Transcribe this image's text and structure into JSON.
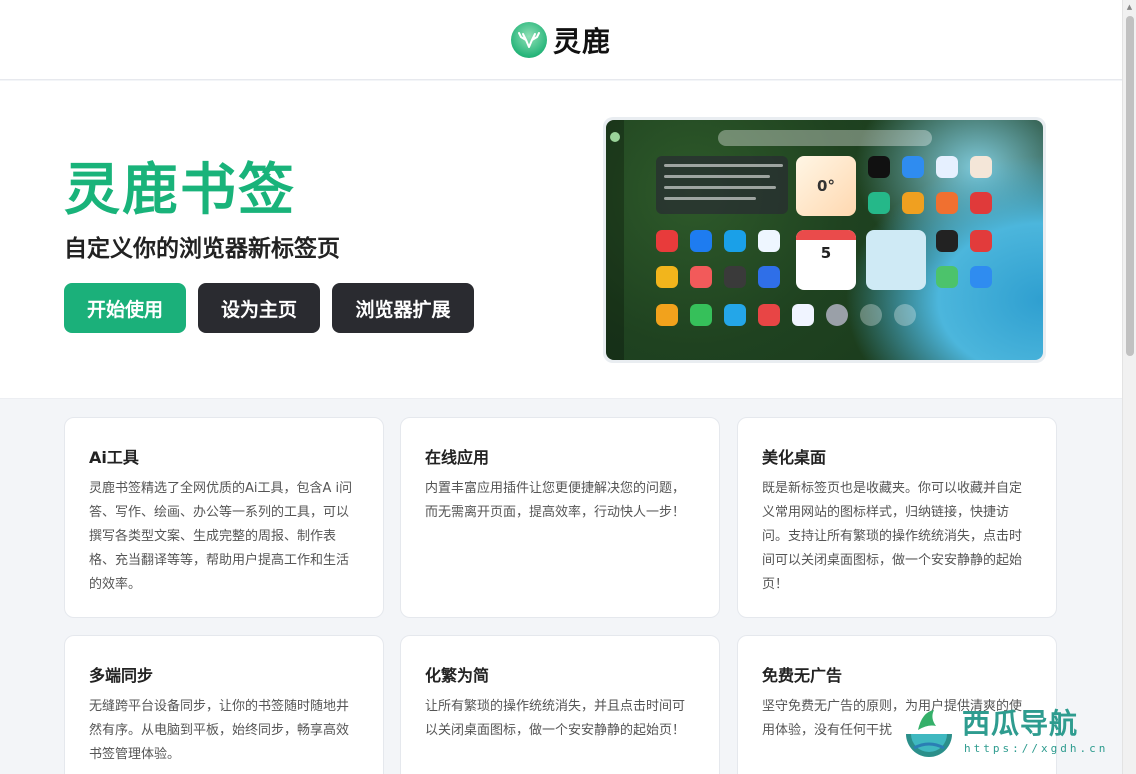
{
  "header": {
    "brand_name": "灵鹿"
  },
  "hero": {
    "title": "灵鹿书签",
    "subtitle": "自定义你的浏览器新标签页",
    "buttons": {
      "start": "开始使用",
      "set_home": "设为主页",
      "extension": "浏览器扩展"
    },
    "preview": {
      "weather_temp": "0°",
      "calendar_day": "5"
    }
  },
  "features": [
    {
      "title": "Ai工具",
      "text": "灵鹿书签精选了全网优质的Ai工具，包含A i问答、写作、绘画、办公等一系列的工具，可以撰写各类型文案、生成完整的周报、制作表格、充当翻译等等，帮助用户提高工作和生活的效率。"
    },
    {
      "title": "在线应用",
      "text": "内置丰富应用插件让您更便捷解决您的问题，而无需离开页面，提高效率，行动快人一步！"
    },
    {
      "title": "美化桌面",
      "text": "既是新标签页也是收藏夹。你可以收藏并自定义常用网站的图标样式，归纳链接，快捷访问。支持让所有繁琐的操作统统消失，点击时间可以关闭桌面图标，做一个安安静静的起始页！"
    },
    {
      "title": "多端同步",
      "text": "无缝跨平台设备同步，让你的书签随时随地井然有序。从电脑到平板，始终同步，畅享高效书签管理体验。"
    },
    {
      "title": "化繁为简",
      "text": "让所有繁琐的操作统统消失，并且点击时间可以关闭桌面图标，做一个安安静静的起始页！"
    },
    {
      "title": "免费无广告",
      "text": "坚守免费无广告的原则，为用户提供清爽的使用体验，没有任何干扰"
    }
  ],
  "watermark": {
    "name": "西瓜导航",
    "url": "https://xgdh.cn"
  },
  "colors": {
    "brand_green": "#1bb07a",
    "dark_button": "#2a2b30"
  }
}
